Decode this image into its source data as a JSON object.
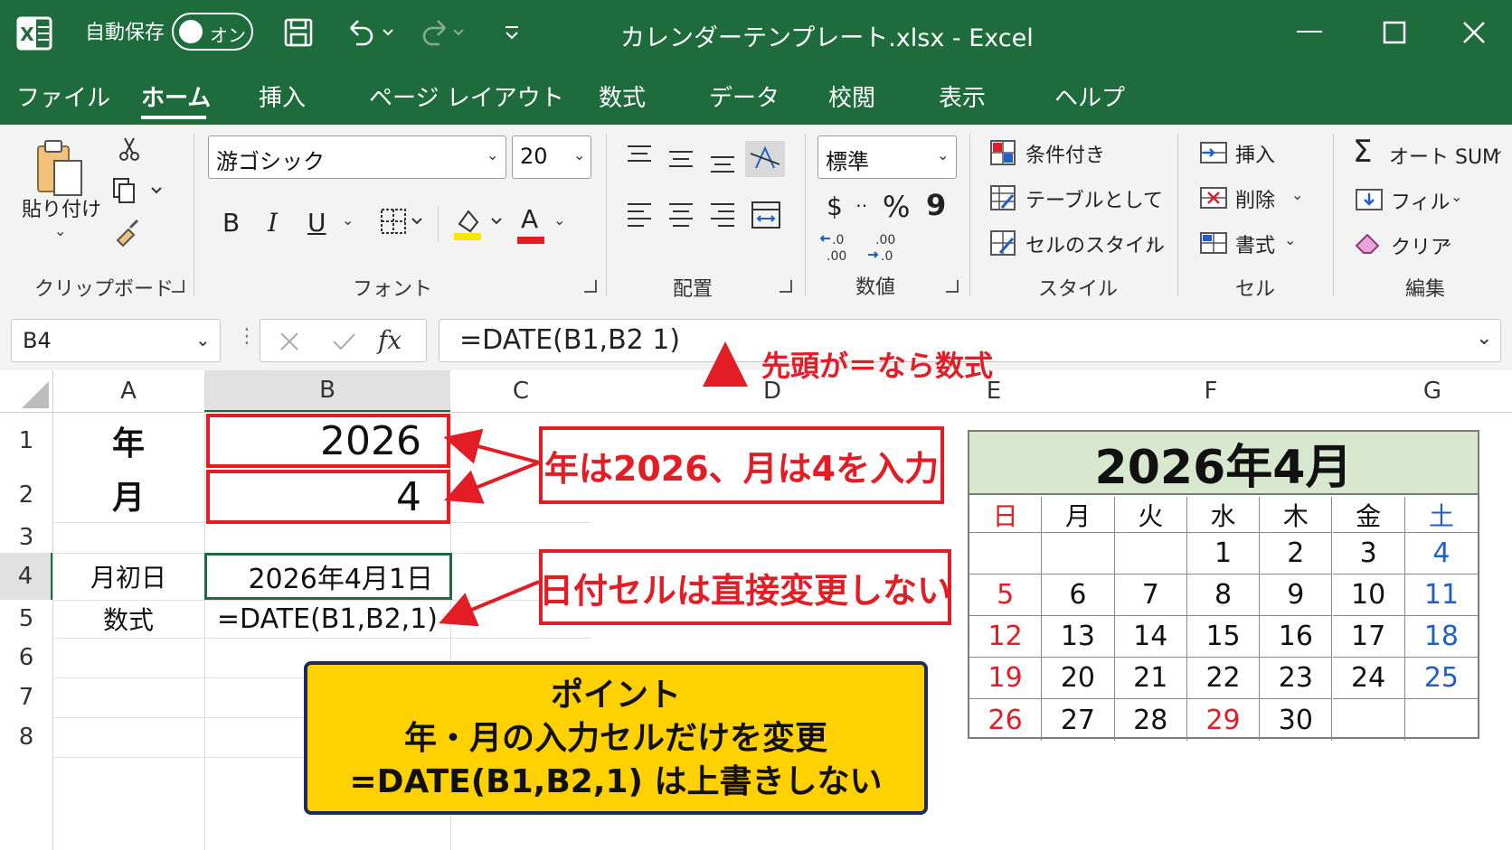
{
  "titlebar": {
    "autosave_label": "自動保存",
    "autosave_toggle": "オン",
    "title": "カレンダーテンプレート.xlsx  -  Excel"
  },
  "menu": {
    "tabs": [
      "ファイル",
      "ホーム",
      "挿入",
      "ページ レイアウト",
      "数式",
      "データ",
      "校閲",
      "表示",
      "ヘルプ"
    ],
    "active": "ホーム"
  },
  "ribbon": {
    "clipboard": {
      "paste": "貼り付け",
      "label": "クリップボード"
    },
    "font": {
      "name": "游ゴシック",
      "size": "20",
      "bold": "B",
      "italic": "I",
      "underline": "U",
      "font_color": "A",
      "label": "フォント"
    },
    "alignment": {
      "label": "配置"
    },
    "number": {
      "format": "標準",
      "currency": "$",
      "percent": "%",
      "comma": "9",
      "inc_decimal": ".0\n.00",
      "dec_decimal": ".00\n→.0",
      "label": "数値"
    },
    "styles": {
      "conditional": "条件付き",
      "as_table": "テーブルとして",
      "cell_styles": "セルのスタイル",
      "label": "スタイル"
    },
    "cells": {
      "insert": "挿入",
      "delete": "削除",
      "format": "書式",
      "label": "セル"
    },
    "editing": {
      "autosum": "オート SUM",
      "fill": "フィル",
      "clear": "クリア",
      "label": "編集"
    }
  },
  "formula_bar": {
    "name_box": "B4",
    "fx": "fx",
    "formula": "=DATE(B1,B2 1)"
  },
  "sheet": {
    "columns": [
      "A",
      "B",
      "C",
      "D",
      "E",
      "F",
      "G"
    ],
    "rows": [
      "1",
      "2",
      "3",
      "4",
      "5",
      "6",
      "7",
      "8"
    ],
    "cells": {
      "A1": "年",
      "B1": "2026",
      "A2": "月",
      "B2": "4",
      "A4": "月初日",
      "B4": "2026年4月1日",
      "A5": "数式",
      "B5": "=DATE(B1,B2,1)"
    }
  },
  "annotations": {
    "formula_hint": "先頭が＝なら数式",
    "input_hint": "年は2026、月は4を入力",
    "date_hint": "日付セルは直接変更しない",
    "point_lines": [
      "ポイント",
      "年・月の入力セルだけを変更",
      "=DATE(B1,B2,1) は上書きしない"
    ]
  },
  "calendar": {
    "title": "2026年4月",
    "weekdays": [
      "日",
      "月",
      "火",
      "水",
      "木",
      "金",
      "土"
    ],
    "weeks": [
      [
        "",
        "",
        "",
        "1",
        "2",
        "3",
        "4"
      ],
      [
        "5",
        "6",
        "7",
        "8",
        "9",
        "10",
        "11"
      ],
      [
        "12",
        "13",
        "14",
        "15",
        "16",
        "17",
        "18"
      ],
      [
        "19",
        "20",
        "21",
        "22",
        "23",
        "24",
        "25"
      ],
      [
        "26",
        "27",
        "28",
        "29",
        "30",
        "",
        ""
      ]
    ],
    "holidays": [
      "29"
    ]
  },
  "colors": {
    "excel_green": "#1e6b3c",
    "annotation_red": "#e21d25",
    "note_yellow": "#ffd100",
    "saturday_blue": "#1f5fc7",
    "calendar_header": "#d8e8cf"
  }
}
